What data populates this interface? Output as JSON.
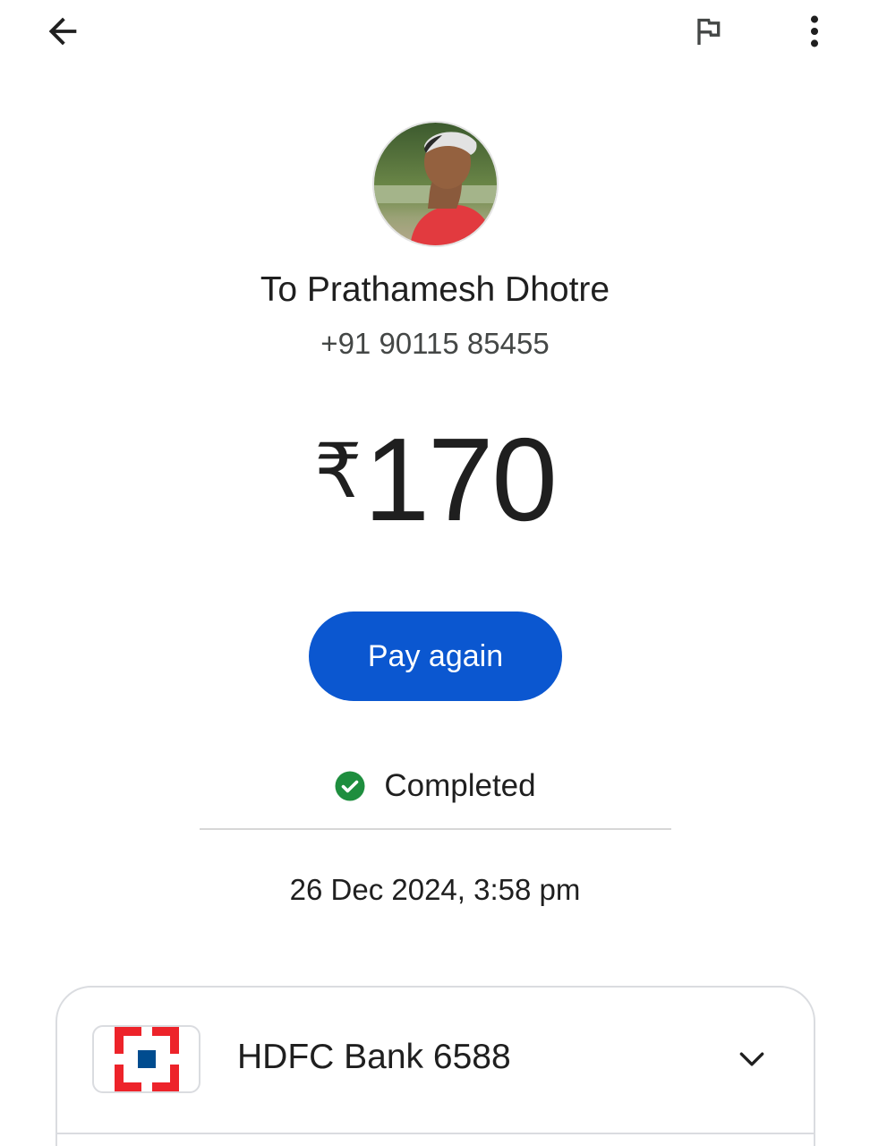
{
  "header": {
    "back_icon": "arrow-back-icon",
    "report_icon": "flag-icon",
    "more_icon": "more-vert-icon"
  },
  "payee": {
    "name": "To Prathamesh Dhotre",
    "phone": "+91 90115 85455",
    "avatar": "profile-photo"
  },
  "payment": {
    "currency_symbol": "₹",
    "amount": "170",
    "pay_again_label": "Pay again",
    "status": "Completed",
    "status_color": "#1e8e3e",
    "datetime": "26 Dec 2024, 3:58 pm"
  },
  "bank": {
    "name": "HDFC Bank 6588",
    "logo": "hdfc-logo",
    "expand_icon": "chevron-down-icon"
  },
  "colors": {
    "accent": "#0b57d0",
    "hdfc_red": "#ed232a",
    "hdfc_blue": "#004c8f"
  }
}
